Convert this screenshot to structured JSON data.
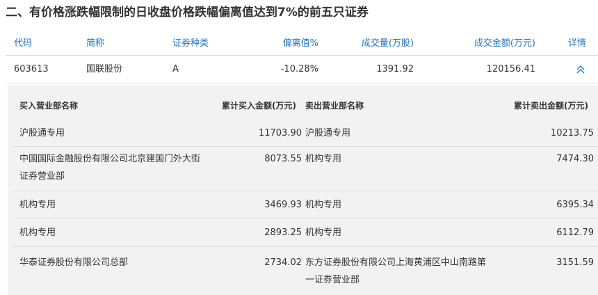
{
  "title": "二、有价格涨跌幅限制的日收盘价格跌幅偏离值达到7%的前五只证券",
  "columns": {
    "code": "代码",
    "name": "简称",
    "type": "证券种类",
    "deviation": "偏离值%",
    "volume": "成交量(万股)",
    "amount": "成交金额(万元)",
    "detail": "详情"
  },
  "rows": [
    {
      "code": "603613",
      "name": "国联股份",
      "type": "A",
      "deviation": "-10.28%",
      "volume": "1391.92",
      "amount": "120156.41",
      "detail_icon": "chevron-up-double-icon"
    }
  ],
  "detail": {
    "headers": {
      "buy_name": "买入营业部名称",
      "buy_amount": "累计买入金额(万元)",
      "sell_name": "卖出营业部名称",
      "sell_amount": "累计卖出金额(万元)"
    },
    "rows": [
      {
        "buy_name": "沪股通专用",
        "buy_amount": "11703.90",
        "sell_name": "沪股通专用",
        "sell_amount": "10213.75"
      },
      {
        "buy_name": "中国国际金融股份有限公司北京建国门外大街证券营业部",
        "buy_amount": "8073.55",
        "sell_name": "机构专用",
        "sell_amount": "7474.30"
      },
      {
        "buy_name": "机构专用",
        "buy_amount": "3469.93",
        "sell_name": "机构专用",
        "sell_amount": "6395.34"
      },
      {
        "buy_name": "机构专用",
        "buy_amount": "2893.25",
        "sell_name": "机构专用",
        "sell_amount": "6112.79"
      },
      {
        "buy_name": "华泰证券股份有限公司总部",
        "buy_amount": "2734.02",
        "sell_name": "东方证券股份有限公司上海黄浦区中山南路第一证券营业部",
        "sell_amount": "3151.59"
      }
    ]
  },
  "colors": {
    "header_text": "#2673b8",
    "accent": "#2673b8",
    "detail_bg": "#f2f2f2"
  }
}
